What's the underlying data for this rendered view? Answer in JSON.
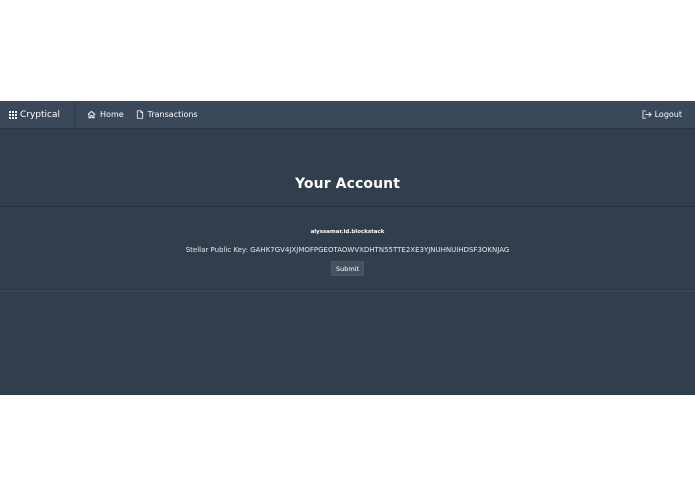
{
  "navbar": {
    "brand_label": "Cryptical",
    "items": [
      {
        "label": "Home",
        "icon": "home-icon"
      },
      {
        "label": "Transactions",
        "icon": "document-icon"
      }
    ],
    "logout_label": "Logout",
    "logout_icon": "logout-icon"
  },
  "header": {
    "title": "Your Account"
  },
  "account": {
    "username": "alyssamar.id.blockstack",
    "public_key_label": "Stellar Public Key:",
    "public_key_value": "GAHK7GV4JXJMOFPGEOTAOWVXDHTN55TTE2XE3YJNUHNUIHDSF3OKNJAG",
    "submit_label": "Submit"
  },
  "colors": {
    "app_background": "#313e4b",
    "navbar_background": "#3a4958",
    "button_background": "#44515e",
    "text": "#ffffff"
  }
}
